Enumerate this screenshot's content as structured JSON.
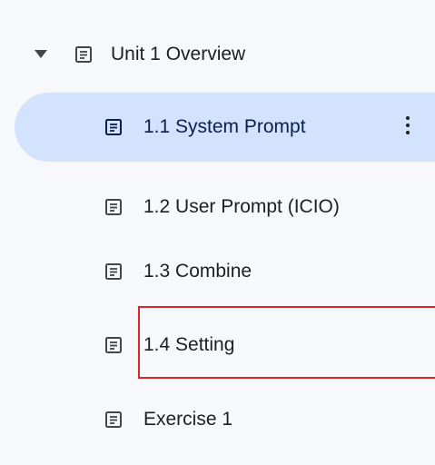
{
  "outline": {
    "unit": {
      "label": "Unit 1 Overview",
      "expanded": true,
      "icon": "doc-icon"
    },
    "items": [
      {
        "label": "1.1 System Prompt",
        "selected": true,
        "icon": "doc-icon",
        "menu_icon": "more-vert-icon"
      },
      {
        "label": "1.2 User Prompt (ICIO)",
        "selected": false,
        "icon": "doc-icon"
      },
      {
        "label": "1.3 Combine",
        "selected": false,
        "icon": "doc-icon"
      },
      {
        "label": "1.4 Setting",
        "selected": false,
        "icon": "doc-icon",
        "highlighted": true
      },
      {
        "label": "Exercise 1",
        "selected": false,
        "icon": "doc-icon"
      }
    ]
  },
  "colors": {
    "background": "#f6f8fb",
    "selected_background": "#d3e3fd",
    "text": "#1f1f1f",
    "highlight_border": "#e02424"
  }
}
